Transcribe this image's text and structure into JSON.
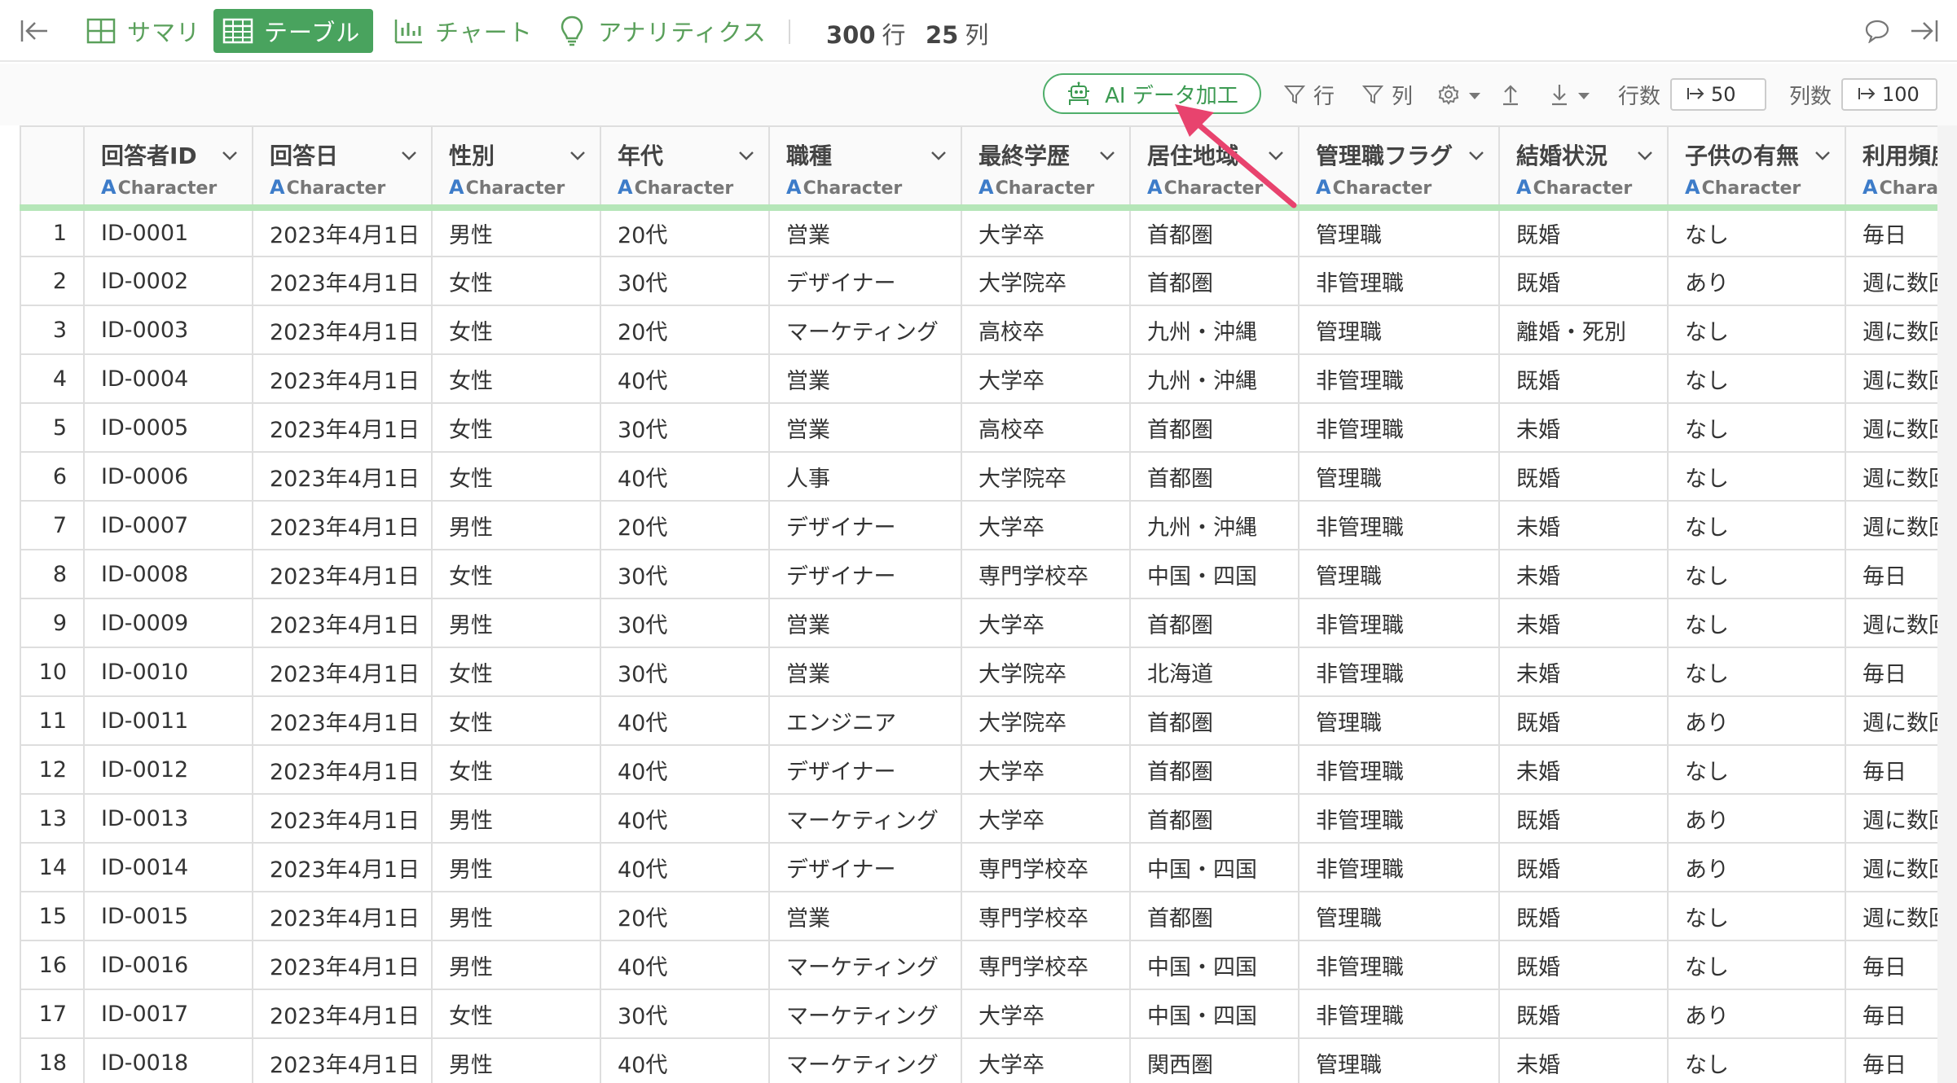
{
  "nav": {
    "tabs": [
      {
        "label": "サマリ",
        "icon": "summary-grid-icon",
        "active": false
      },
      {
        "label": "テーブル",
        "icon": "table-icon",
        "active": true
      },
      {
        "label": "チャート",
        "icon": "bar-chart-icon",
        "active": false
      },
      {
        "label": "アナリティクス",
        "icon": "lightbulb-icon",
        "active": false
      }
    ],
    "rows_count": "300",
    "rows_label": "行",
    "cols_count": "25",
    "cols_label": "列"
  },
  "toolbar": {
    "ai_label": "AI データ加工",
    "row_filter_label": "行",
    "col_filter_label": "列",
    "rows_label": "行数",
    "rows_value": "50",
    "cols_label": "列数",
    "cols_value": "100"
  },
  "accent_color": "#49a35e",
  "table": {
    "columns": [
      {
        "name": "回答者ID",
        "type": "Character"
      },
      {
        "name": "回答日",
        "type": "Character"
      },
      {
        "name": "性別",
        "type": "Character"
      },
      {
        "name": "年代",
        "type": "Character"
      },
      {
        "name": "職種",
        "type": "Character"
      },
      {
        "name": "最終学歴",
        "type": "Character"
      },
      {
        "name": "居住地域",
        "type": "Character"
      },
      {
        "name": "管理職フラグ",
        "type": "Character"
      },
      {
        "name": "結婚状況",
        "type": "Character"
      },
      {
        "name": "子供の有無",
        "type": "Character"
      },
      {
        "name": "利用頻度",
        "type": "Character"
      }
    ],
    "rows": [
      [
        "1",
        "ID-0001",
        "2023年4月1日",
        "男性",
        "20代",
        "営業",
        "大学卒",
        "首都圏",
        "管理職",
        "既婚",
        "なし",
        "毎日"
      ],
      [
        "2",
        "ID-0002",
        "2023年4月1日",
        "女性",
        "30代",
        "デザイナー",
        "大学院卒",
        "首都圏",
        "非管理職",
        "既婚",
        "あり",
        "週に数回"
      ],
      [
        "3",
        "ID-0003",
        "2023年4月1日",
        "女性",
        "20代",
        "マーケティング",
        "高校卒",
        "九州・沖縄",
        "管理職",
        "離婚・死別",
        "なし",
        "週に数回"
      ],
      [
        "4",
        "ID-0004",
        "2023年4月1日",
        "女性",
        "40代",
        "営業",
        "大学卒",
        "九州・沖縄",
        "非管理職",
        "既婚",
        "なし",
        "週に数回"
      ],
      [
        "5",
        "ID-0005",
        "2023年4月1日",
        "女性",
        "30代",
        "営業",
        "高校卒",
        "首都圏",
        "非管理職",
        "未婚",
        "なし",
        "週に数回"
      ],
      [
        "6",
        "ID-0006",
        "2023年4月1日",
        "女性",
        "40代",
        "人事",
        "大学院卒",
        "首都圏",
        "管理職",
        "既婚",
        "なし",
        "週に数回"
      ],
      [
        "7",
        "ID-0007",
        "2023年4月1日",
        "男性",
        "20代",
        "デザイナー",
        "大学卒",
        "九州・沖縄",
        "非管理職",
        "未婚",
        "なし",
        "週に数回"
      ],
      [
        "8",
        "ID-0008",
        "2023年4月1日",
        "女性",
        "30代",
        "デザイナー",
        "専門学校卒",
        "中国・四国",
        "管理職",
        "未婚",
        "なし",
        "毎日"
      ],
      [
        "9",
        "ID-0009",
        "2023年4月1日",
        "男性",
        "30代",
        "営業",
        "大学卒",
        "首都圏",
        "非管理職",
        "未婚",
        "なし",
        "週に数回"
      ],
      [
        "10",
        "ID-0010",
        "2023年4月1日",
        "女性",
        "30代",
        "営業",
        "大学院卒",
        "北海道",
        "非管理職",
        "未婚",
        "なし",
        "毎日"
      ],
      [
        "11",
        "ID-0011",
        "2023年4月1日",
        "女性",
        "40代",
        "エンジニア",
        "大学院卒",
        "首都圏",
        "管理職",
        "既婚",
        "あり",
        "週に数回"
      ],
      [
        "12",
        "ID-0012",
        "2023年4月1日",
        "女性",
        "40代",
        "デザイナー",
        "大学卒",
        "首都圏",
        "非管理職",
        "未婚",
        "なし",
        "毎日"
      ],
      [
        "13",
        "ID-0013",
        "2023年4月1日",
        "男性",
        "40代",
        "マーケティング",
        "大学卒",
        "首都圏",
        "非管理職",
        "既婚",
        "あり",
        "週に数回"
      ],
      [
        "14",
        "ID-0014",
        "2023年4月1日",
        "男性",
        "40代",
        "デザイナー",
        "専門学校卒",
        "中国・四国",
        "非管理職",
        "既婚",
        "あり",
        "週に数回"
      ],
      [
        "15",
        "ID-0015",
        "2023年4月1日",
        "男性",
        "20代",
        "営業",
        "専門学校卒",
        "首都圏",
        "管理職",
        "既婚",
        "なし",
        "週に数回"
      ],
      [
        "16",
        "ID-0016",
        "2023年4月1日",
        "男性",
        "40代",
        "マーケティング",
        "専門学校卒",
        "中国・四国",
        "非管理職",
        "既婚",
        "なし",
        "毎日"
      ],
      [
        "17",
        "ID-0017",
        "2023年4月1日",
        "女性",
        "30代",
        "マーケティング",
        "大学卒",
        "中国・四国",
        "非管理職",
        "既婚",
        "あり",
        "毎日"
      ],
      [
        "18",
        "ID-0018",
        "2023年4月1日",
        "男性",
        "40代",
        "マーケティング",
        "大学卒",
        "関西圏",
        "管理職",
        "未婚",
        "なし",
        "毎日"
      ]
    ]
  }
}
